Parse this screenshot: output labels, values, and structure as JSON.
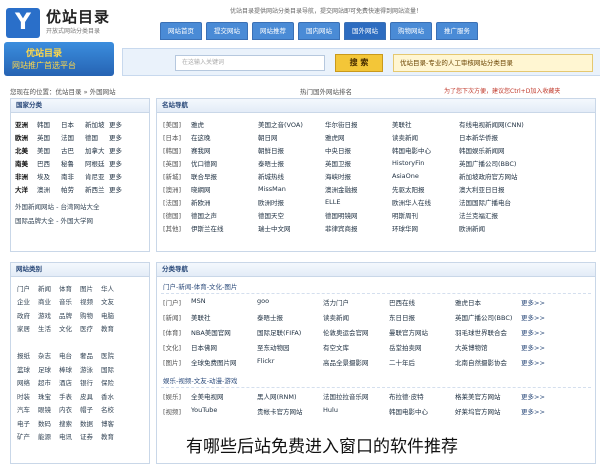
{
  "header": {
    "logo_mark": "Y",
    "logo_title": "优站目录",
    "logo_sub": "开放式网站分类目录",
    "top_notice": "优站目录提供网站分类目录导航，提交网站即可免费快速得到网站流量！",
    "nav": [
      "网站首页",
      "提交网站",
      "网站推荐",
      "国内网站",
      "国外网站",
      "购物网站",
      "推广服务"
    ],
    "banner_line1": "优站目录",
    "banner_line2": "网站推广首选平台",
    "search_placeholder": "在这输入关键词",
    "search_button": "搜 索",
    "promo": "优站目录-专业的人工审核网站分类目录"
  },
  "location": "您现在的位置：优站目录 » 外国网站",
  "hot_rank": "热门国外网站排名",
  "tip": "为了您下次方便，建议您Ctrl+D加入收藏夹",
  "country_panel": {
    "title": "国家分类",
    "rows": [
      [
        "亚洲",
        "韩国",
        "日本",
        "新加坡",
        "更多"
      ],
      [
        "欧洲",
        "英国",
        "法国",
        "德国",
        "更多"
      ],
      [
        "北美",
        "美国",
        "古巴",
        "加拿大",
        "更多"
      ],
      [
        "南美",
        "巴西",
        "秘鲁",
        "阿根廷",
        "更多"
      ],
      [
        "非洲",
        "埃及",
        "南非",
        "肯尼亚",
        "更多"
      ],
      [
        "大洋",
        "澳洲",
        "帕劳",
        "新西兰",
        "更多"
      ]
    ],
    "links": [
      "外国新闻网站 - 台湾网站大全",
      "国际品牌大全 - 外国大学网"
    ]
  },
  "site_panel": {
    "title": "名站导航",
    "rows": [
      {
        "cat": "[美国]",
        "sites": [
          "雅虎",
          "美国之音(VOA)",
          "华尔街日报",
          "美联社",
          "有线电视新闻网(CNN)"
        ]
      },
      {
        "cat": "[日本]",
        "sites": [
          "在这晚",
          "朝日网",
          "雅虎网",
          "读卖新闻",
          "日本新华侨报"
        ]
      },
      {
        "cat": "[韩国]",
        "sites": [
          "赛我网",
          "朝鲜日报",
          "中央日报",
          "韩国电影中心",
          "韩国娱乐新闻网"
        ]
      },
      {
        "cat": "[英国]",
        "sites": [
          "优口德网",
          "泰晤士报",
          "英国卫报",
          "HistoryFin",
          "英国广播公司(BBC)"
        ]
      },
      {
        "cat": "[新城]",
        "sites": [
          "联合早报",
          "新城热线",
          "海峡时报",
          "AsiaOne",
          "新加坡政府官方网站"
        ]
      },
      {
        "cat": "[澳洲]",
        "sites": [
          "晓網网",
          "MissMan",
          "澳洲金融报",
          "先驱太阳报",
          "澳大利亚日日报"
        ]
      },
      {
        "cat": "[法国]",
        "sites": [
          "新欧洲",
          "欧洲时报",
          "ELLE",
          "欧洲华人在线",
          "法国国际广播电台"
        ]
      },
      {
        "cat": "[德国]",
        "sites": [
          "德国之声",
          "德国天空",
          "德国明镜网",
          "明斯周刊",
          "法兰克福汇报"
        ]
      },
      {
        "cat": "[其他]",
        "sites": [
          "伊斯兰在线",
          "瑞士中文网",
          "菲律宾商报",
          "环球华网",
          "欧洲新闻"
        ]
      }
    ]
  },
  "class_panel": {
    "title": "网站类别",
    "rows": [
      [
        "门户",
        "新闻",
        "体育",
        "图片",
        "华人"
      ],
      [
        "企业",
        "商业",
        "音乐",
        "视频",
        "文友"
      ],
      [
        "政府",
        "游戏",
        "品牌",
        "购物",
        "电脑"
      ],
      [
        "家居",
        "生活",
        "文化",
        "医疗",
        "教育"
      ],
      [
        "",
        "",
        "",
        "",
        ""
      ],
      [
        "报纸",
        "杂志",
        "电台",
        "奢品",
        "医院"
      ],
      [
        "篮球",
        "足球",
        "棒球",
        "游泳",
        "国际"
      ],
      [
        "网络",
        "超市",
        "酒店",
        "银行",
        "保险"
      ],
      [
        "时装",
        "珠宝",
        "手表",
        "皮具",
        "香水"
      ],
      [
        "汽车",
        "眼镜",
        "内衣",
        "帽子",
        "名校"
      ],
      [
        "电子",
        "数码",
        "搜索",
        "数据",
        "博客"
      ],
      [
        "矿产",
        "能源",
        "电讯",
        "证券",
        "教育"
      ]
    ]
  },
  "cat_panel": {
    "title": "分类导航",
    "group1": "门户-新闻-体育-文化-图片",
    "group1_rows": [
      {
        "cat": "[门户]",
        "sites": [
          "MSN",
          "goo",
          "活力门户",
          "巴西在线",
          "雅虎日本"
        ],
        "more": "更多>>"
      },
      {
        "cat": "[新闻]",
        "sites": [
          "美联社",
          "泰晤士报",
          "读卖新闻",
          "东日日报",
          "英国广播公司(BBC)"
        ],
        "more": "更多>>"
      },
      {
        "cat": "[体育]",
        "sites": [
          "NBA美国官网",
          "国际足联(FIFA)",
          "伦敦奥运会官网",
          "曼联官方网站",
          "羽毛球世界联合会"
        ],
        "more": "更多>>"
      },
      {
        "cat": "[文化]",
        "sites": [
          "日本佛网",
          "至东动物园",
          "有空文库",
          "岳堂拍卖网",
          "大英博物馆"
        ],
        "more": "更多>>"
      },
      {
        "cat": "[图片]",
        "sites": [
          "全球免费图片网",
          "Flickr",
          "高品全景摄影网",
          "二十年后",
          "北南自然摄影协会"
        ],
        "more": "更多>>"
      }
    ],
    "group2": "娱乐-视频-文友-动漫-游戏",
    "group2_rows": [
      {
        "cat": "[娱乐]",
        "sites": [
          "全美电视网",
          "黑人网(RNM)",
          "法国拉拉音乐网",
          "布拉德·皮特",
          "格莱美官方网站"
        ],
        "more": "更多>>"
      },
      {
        "cat": "[视频]",
        "sites": [
          "YouTube",
          "贵帐卡官方网站",
          "Hulu",
          "韩国电影中心",
          "好莱坞官方网站"
        ],
        "more": "更多>>"
      }
    ]
  },
  "caption": "有哪些后站免费进入窗口的软件推荐"
}
